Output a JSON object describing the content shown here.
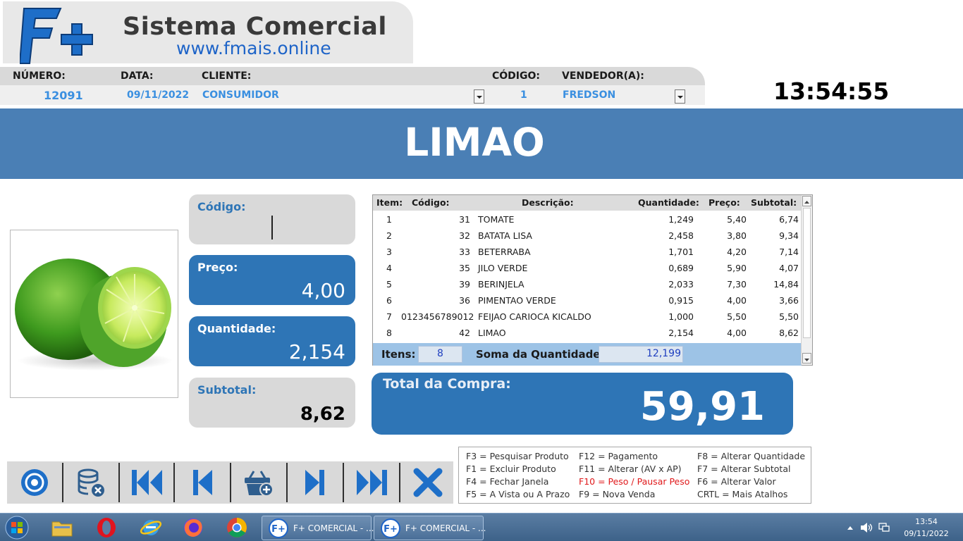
{
  "logo": {
    "mark_text": "F+",
    "title": "Sistema Comercial",
    "url": "www.fmais.online"
  },
  "header": {
    "numero_label": "NÚMERO:",
    "numero": "12091",
    "data_label": "DATA:",
    "data": "09/11/2022",
    "cliente_label": "CLIENTE:",
    "cliente": "CONSUMIDOR",
    "codigo_label": "CÓDIGO:",
    "codigo": "1",
    "vendedor_label": "VENDEDOR(A):",
    "vendedor": "FREDSON"
  },
  "clock": "13:54:55",
  "banner": {
    "product_name": "LIMAO"
  },
  "fields": {
    "codigo_label": "Código:",
    "codigo_value": "",
    "preco_label": "Preço:",
    "preco_value": "4,00",
    "quantidade_label": "Quantidade:",
    "quantidade_value": "2,154",
    "subtotal_label": "Subtotal:",
    "subtotal_value": "8,62"
  },
  "table": {
    "headers": [
      "Item:",
      "Código:",
      "Descrição:",
      "Quantidade:",
      "Preço:",
      "Subtotal:"
    ],
    "rows": [
      {
        "item": "1",
        "codigo": "31",
        "descricao": "TOMATE",
        "quantidade": "1,249",
        "preco": "5,40",
        "subtotal": "6,74"
      },
      {
        "item": "2",
        "codigo": "32",
        "descricao": "BATATA LISA",
        "quantidade": "2,458",
        "preco": "3,80",
        "subtotal": "9,34"
      },
      {
        "item": "3",
        "codigo": "33",
        "descricao": "BETERRABA",
        "quantidade": "1,701",
        "preco": "4,20",
        "subtotal": "7,14"
      },
      {
        "item": "4",
        "codigo": "35",
        "descricao": "JILO VERDE",
        "quantidade": "0,689",
        "preco": "5,90",
        "subtotal": "4,07"
      },
      {
        "item": "5",
        "codigo": "39",
        "descricao": "BERINJELA",
        "quantidade": "2,033",
        "preco": "7,30",
        "subtotal": "14,84"
      },
      {
        "item": "6",
        "codigo": "36",
        "descricao": "PIMENTAO VERDE",
        "quantidade": "0,915",
        "preco": "4,00",
        "subtotal": "3,66"
      },
      {
        "item": "7",
        "codigo": "0123456789012",
        "descricao": "FEIJAO CARIOCA KICALDO",
        "quantidade": "1,000",
        "preco": "5,50",
        "subtotal": "5,50"
      },
      {
        "item": "8",
        "codigo": "42",
        "descricao": "LIMAO",
        "quantidade": "2,154",
        "preco": "4,00",
        "subtotal": "8,62"
      }
    ],
    "footer": {
      "itens_label": "Itens:",
      "itens": "8",
      "soma_label": "Soma da Quantidade:",
      "soma": "12,199"
    }
  },
  "total": {
    "label": "Total da Compra:",
    "value": "59,91"
  },
  "toolbar": {
    "buttons": [
      "record-icon",
      "database-remove-icon",
      "first-icon",
      "previous-icon",
      "basket-add-icon",
      "next-icon",
      "last-icon",
      "close-icon"
    ]
  },
  "shortcuts": {
    "col1": [
      "F3 = Pesquisar Produto",
      "F1 = Excluir Produto",
      "F4 = Fechar Janela",
      "F5 = A Vista ou A Prazo"
    ],
    "col2": [
      "F12 = Pagamento",
      "F11 = Alterar (AV x AP)",
      "F10 = Peso / Pausar Peso",
      "F9 = Nova Venda"
    ],
    "col3": [
      "F8 = Alterar Quantidade",
      "F7 = Alterar Subtotal",
      "F6 = Alterar Valor",
      "CRTL = Mais Atalhos"
    ],
    "highlight_color": "#e0191b"
  },
  "taskbar": {
    "task1": "F+ COMERCIAL - ...",
    "task2": "F+ COMERCIAL - ...",
    "time": "13:54",
    "date": "09/11/2022"
  },
  "colors": {
    "banner": "#4a7fb5",
    "accent_blue": "#2e75b6",
    "table_footer": "#9dc3e6"
  }
}
